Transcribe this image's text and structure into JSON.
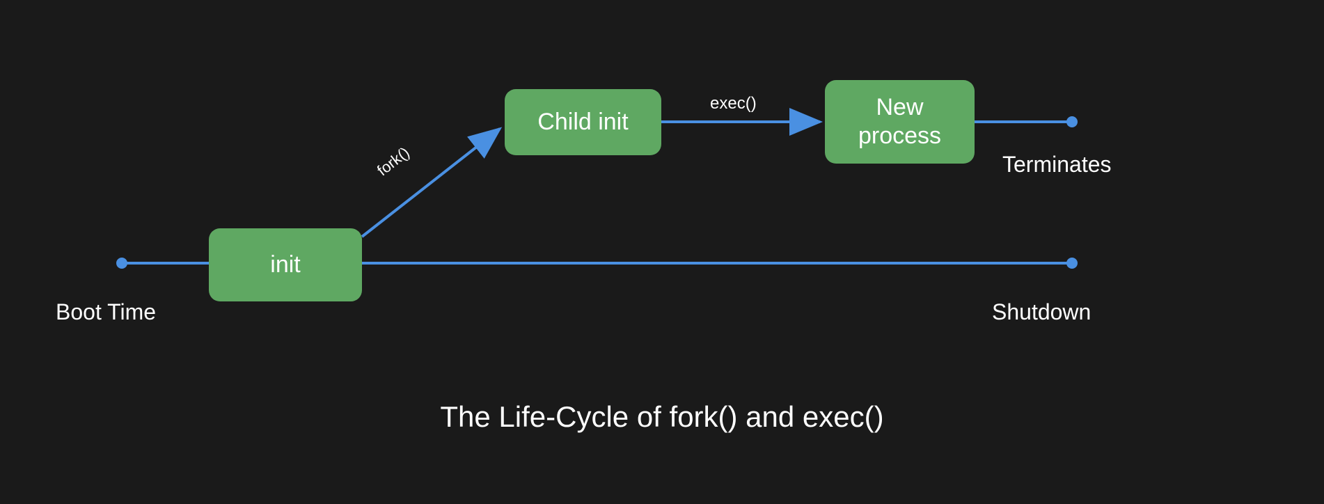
{
  "title": "The Life-Cycle of fork() and exec()",
  "nodes": {
    "init": "init",
    "child_init": "Child init",
    "new_process": "New\nprocess"
  },
  "edges": {
    "fork": "fork()",
    "exec": "exec()"
  },
  "timeline": {
    "start": "Boot Time",
    "end": "Shutdown",
    "child_end": "Terminates"
  },
  "colors": {
    "background": "#1a1a1a",
    "node_fill": "#5fa862",
    "line": "#4a90e2",
    "text": "#ffffff"
  }
}
